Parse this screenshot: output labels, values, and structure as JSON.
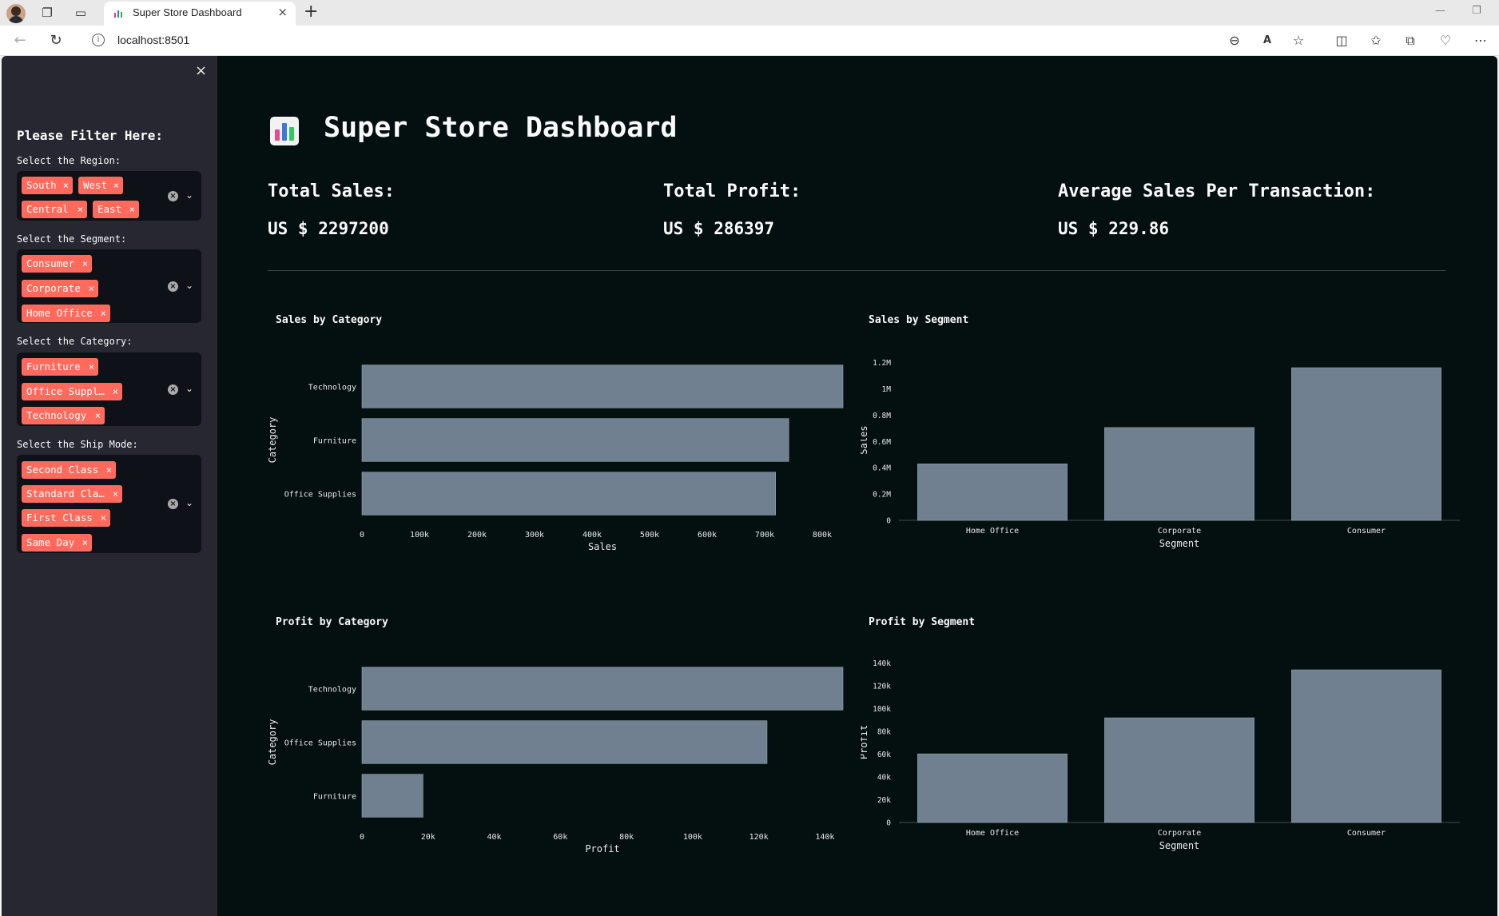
{
  "browser": {
    "tab_title": "Super Store Dashboard",
    "url": "localhost:8501",
    "new_tab_symbol": "+",
    "tab_close_symbol": "×"
  },
  "sidebar": {
    "close_symbol": "×",
    "title": "Please Filter Here:",
    "filters": [
      {
        "label": "Select the Region:",
        "tags": [
          "South",
          "West",
          "Central",
          "East"
        ]
      },
      {
        "label": "Select the Segment:",
        "tags": [
          "Consumer",
          "Corporate",
          "Home Office"
        ]
      },
      {
        "label": "Select the Category:",
        "tags": [
          "Furniture",
          "Office Suppl…",
          "Technology"
        ]
      },
      {
        "label": "Select the Ship Mode:",
        "tags": [
          "Second Class",
          "Standard Cla…",
          "First Class",
          "Same Day"
        ]
      }
    ],
    "tag_remove_symbol": "×"
  },
  "main": {
    "title": "Super Store Dashboard",
    "metrics": [
      {
        "label": "Total Sales:",
        "value": "US $ 2297200"
      },
      {
        "label": "Total Profit:",
        "value": "US $ 286397"
      },
      {
        "label": "Average Sales Per Transaction:",
        "value": "US $ 229.86"
      }
    ]
  },
  "colors": {
    "bar": "#708090",
    "tag": "#ff6a5d",
    "app_background": "#040f10",
    "sidebar_background": "#262730"
  },
  "icons": {
    "title_icon": "bar-chart-emoji-icon",
    "tag_remove": "close-icon",
    "clear": "clear-all-icon",
    "dropdown": "chevron-down-icon"
  },
  "chart_data": [
    {
      "id": "sales-by-category",
      "type": "bar",
      "orientation": "horizontal",
      "title": "Sales by Category",
      "xlabel": "Sales",
      "ylabel": "Category",
      "categories": [
        "Technology",
        "Furniture",
        "Office Supplies"
      ],
      "values": [
        836154,
        741999,
        719047
      ],
      "xlim": [
        0,
        836154
      ],
      "ticks": [
        0,
        100000,
        200000,
        300000,
        400000,
        500000,
        600000,
        700000,
        800000
      ],
      "tick_labels": [
        "0",
        "100k",
        "200k",
        "300k",
        "400k",
        "500k",
        "600k",
        "700k",
        "800k"
      ]
    },
    {
      "id": "sales-by-segment",
      "type": "bar",
      "orientation": "vertical",
      "title": "Sales by Segment",
      "xlabel": "Segment",
      "ylabel": "Sales",
      "categories": [
        "Home Office",
        "Corporate",
        "Consumer"
      ],
      "values": [
        429653,
        706146,
        1161401
      ],
      "ylim": [
        0,
        1222527
      ],
      "ticks": [
        0,
        200000,
        400000,
        600000,
        800000,
        1000000,
        1200000
      ],
      "tick_labels": [
        "0",
        "0.2M",
        "0.4M",
        "0.6M",
        "0.8M",
        "1M",
        "1.2M"
      ]
    },
    {
      "id": "profit-by-category",
      "type": "bar",
      "orientation": "horizontal",
      "title": "Profit by Category",
      "xlabel": "Profit",
      "ylabel": "Category",
      "categories": [
        "Technology",
        "Office Supplies",
        "Furniture"
      ],
      "values": [
        145455,
        122491,
        18451
      ],
      "xlim": [
        0,
        145455
      ],
      "ticks": [
        0,
        20000,
        40000,
        60000,
        80000,
        100000,
        120000,
        140000
      ],
      "tick_labels": [
        "0",
        "20k",
        "40k",
        "60k",
        "80k",
        "100k",
        "120k",
        "140k"
      ]
    },
    {
      "id": "profit-by-segment",
      "type": "bar",
      "orientation": "vertical",
      "title": "Profit by Segment",
      "xlabel": "Segment",
      "ylabel": "Profit",
      "categories": [
        "Home Office",
        "Corporate",
        "Consumer"
      ],
      "values": [
        60299,
        91979,
        134119
      ],
      "ylim": [
        0,
        141178
      ],
      "ticks": [
        0,
        20000,
        40000,
        60000,
        80000,
        100000,
        120000,
        140000
      ],
      "tick_labels": [
        "0",
        "20k",
        "40k",
        "60k",
        "80k",
        "100k",
        "120k",
        "140k"
      ]
    }
  ]
}
